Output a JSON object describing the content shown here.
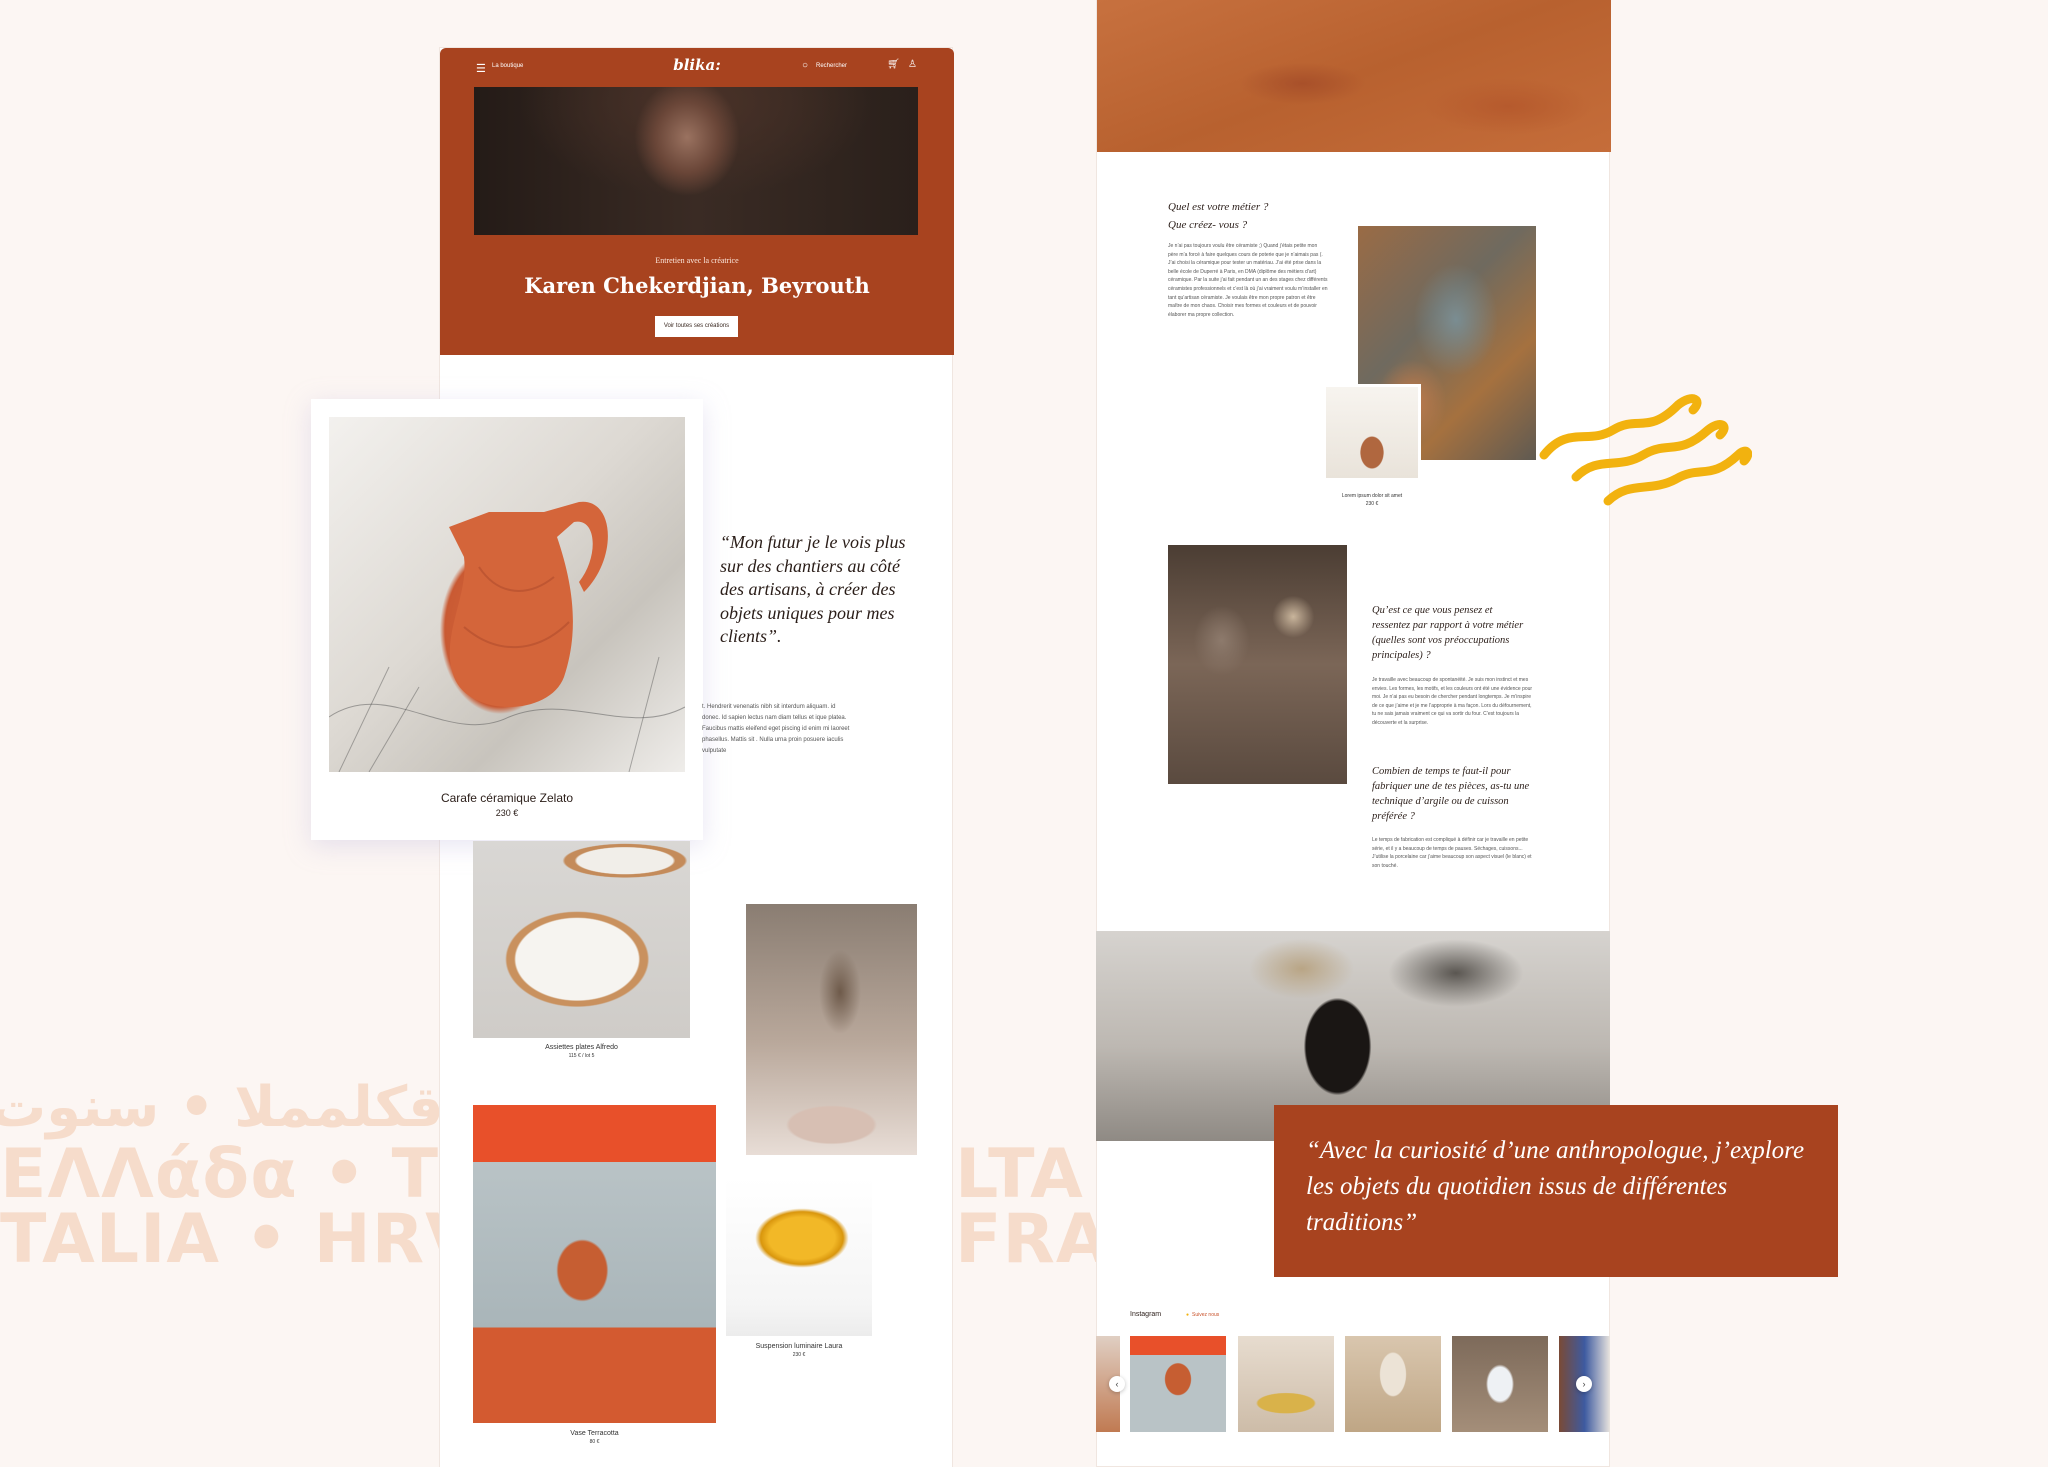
{
  "background_words": {
    "line1": "قكلمملا • سنوت",
    "line2": "ΕΛΛάδα • TÜRK",
    "line2b": "LTA",
    "line3": "TALIA • HRVAT",
    "line3b": "FRAI"
  },
  "left_page": {
    "nav": {
      "menu_label": "La boutique",
      "logo": "blika:",
      "search_label": "Rechercher",
      "cart_count": "0"
    },
    "hero": {
      "kicker": "Entretien avec la créatrice",
      "title": "Karen Chekerdjian, Beyrouth",
      "button": "Voir toutes ses créations"
    },
    "product_card": {
      "name": "Carafe céramique Zelato",
      "price": "230 €"
    },
    "quote": "“Mon futur je le vois plus sur des chantiers au côté des artisans, à créer des objets uniques pour mes clients”.",
    "lorem": "t. Hendrerit venenatis nibh sit interdum aliquam. id donec. Id sapien lectus nam diam tellus et ique platea. Faucibus mattis eleifend eget piscing id enim mi laoreet phasellus. Mattis sit . Nulla urna proin posuere iaculis vulputate",
    "products": [
      {
        "name": "Assiettes plates Alfredo",
        "price": "115 € / lot 5"
      },
      {
        "name": "Suspension luminaire Laura",
        "price": "230 €"
      },
      {
        "name": "Vase Terracotta",
        "price": "80 €"
      }
    ]
  },
  "right_page": {
    "q1": {
      "title_line1": "Quel est votre métier ?",
      "title_line2": "Que créez- vous ?",
      "text": "Je n’ai pas toujours voulu être céramiste ;) Quand j’étais petite mon père m’a forcé à faire quelques cours de poterie que je n’aimais pas (. J’ai choisi la céramique pour tester un matériau. J’ai été prise dans la belle école de Duperré à Paris, en DMA (diplôme des métiers d’art) céramique. Par la suite j’ai fait pendant un an des stages chez différents céramistes professionnels et c’est là où j’ai vraiment voulu m’installer en tant qu’artisan céramiste. Je voulais être mon propre patron et être maître de mon chaos. Choisir mes formes et couleurs et de pouvoir élaborer ma propre collection."
    },
    "small_product": {
      "name": "Lorem ipsum dolor sit amet",
      "price": "230 €"
    },
    "q2": {
      "title": "Qu’est ce que vous pensez et ressentez par rapport à votre métier (quelles sont vos préoccupations principales) ?",
      "text": "Je travaille avec beaucoup de spontanéité. Je suis mon instinct et mes envies. Les formes, les motifs, et les couleurs ont été une évidence pour moi. Je n’ai pas eu besoin de chercher pendant longtemps. Je m’inspire de ce que j’aime et je me l’approprie à ma façon. Lors du défournement, tu ne sais jamais vraiment ce qui va sortir du four. C’est toujours la découverte et la surprise."
    },
    "q3": {
      "title": "Combien de temps te faut-il pour fabriquer une de tes pièces, as-tu une technique d’argile ou de cuisson préférée ?",
      "text": "Le temps de fabrication est compliqué à définir car je travaille en petite série, et il y a beaucoup de temps de pauses. Séchages, cuissons... J’utilise la porcelaine car j’aime beaucoup son aspect visuel (le blanc) et son touché."
    },
    "quote": "“Avec la curiosité d’une anthropologue, j’explore les objets du quotidien issus de différentes traditions”",
    "instagram": {
      "label": "Instagram",
      "follow": "Suivez nous"
    }
  },
  "colors": {
    "brand": "#a8431f",
    "accent_yellow": "#f2b20f",
    "background": "#fcf6f3"
  }
}
